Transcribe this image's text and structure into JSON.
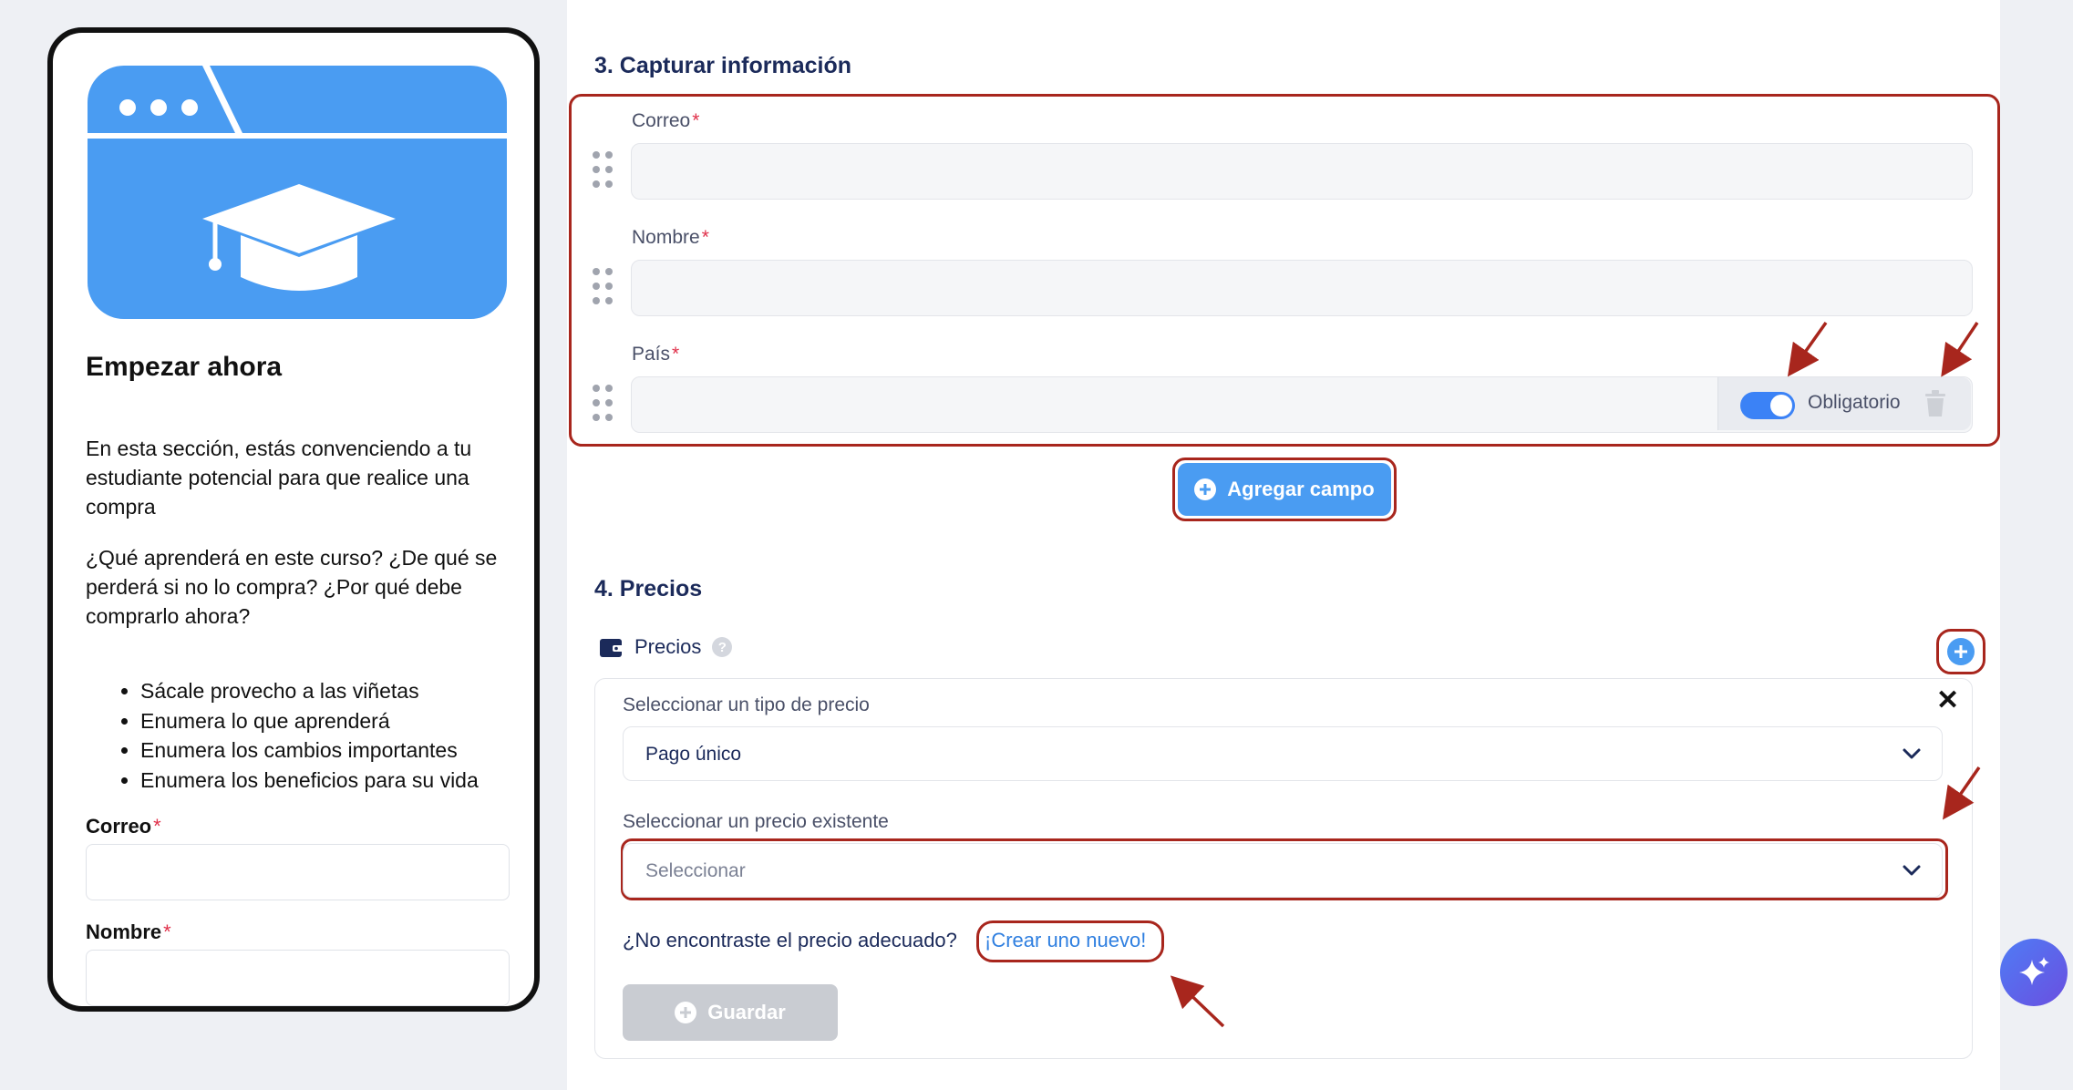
{
  "preview": {
    "title": "Empezar ahora",
    "paragraph1": "En esta sección, estás convenciendo a tu estudiante potencial para que realice una compra",
    "paragraph2": "¿Qué aprenderá en este curso? ¿De qué se perderá si no lo compra? ¿Por qué debe comprarlo ahora?",
    "bullets": [
      "Sácale provecho a las viñetas",
      "Enumera lo que aprenderá",
      "Enumera los cambios importantes",
      "Enumera los beneficios para su vida"
    ],
    "email_label": "Correo",
    "name_label": "Nombre",
    "required_mark": "*",
    "hero_icon": "graduation-cap-icon"
  },
  "capture": {
    "title": "3. Capturar información",
    "fields": [
      {
        "label": "Correo",
        "required": "*"
      },
      {
        "label": "Nombre",
        "required": "*"
      },
      {
        "label": "País",
        "required": "*"
      }
    ],
    "toggle_label": "Obligatorio",
    "toggle_on": true,
    "add_field_label": "Agregar campo"
  },
  "prices": {
    "title": "4. Precios",
    "section_label": "Precios",
    "help_glyph": "?",
    "close_glyph": "✕",
    "type_label": "Seleccionar un tipo de precio",
    "type_value": "Pago único",
    "existing_label": "Seleccionar un precio existente",
    "existing_placeholder": "Seleccionar",
    "not_found_text": "¿No encontraste el precio adecuado?",
    "create_link": "¡Crear uno nuevo!",
    "save_label": "Guardar"
  },
  "colors": {
    "accent": "#4a9cf2",
    "annotation_red": "#a8261d",
    "required_red": "#e0304a",
    "heading_navy": "#1b2a5a",
    "disabled_gray": "#c9ccd2"
  }
}
